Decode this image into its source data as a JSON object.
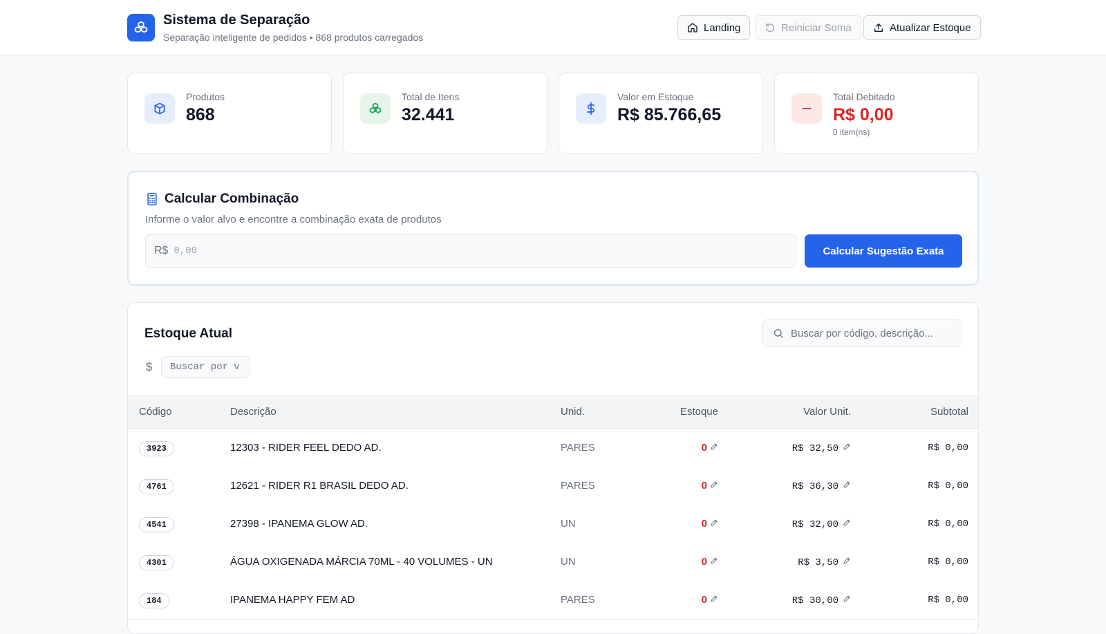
{
  "header": {
    "title": "Sistema de Separação",
    "subtitle": "Separação inteligente de pedidos • 868 produtos carregados",
    "buttons": {
      "landing": "Landing",
      "reset": "Reiniciar Soma",
      "update": "Atualizar Estoque"
    }
  },
  "stats": [
    {
      "label": "Produtos",
      "value": "868",
      "icon": "cube-icon",
      "color": "#2563eb"
    },
    {
      "label": "Total de Itens",
      "value": "32.441",
      "icon": "boxes-icon",
      "color": "#16a34a"
    },
    {
      "label": "Valor em Estoque",
      "value": "R$ 85.766,65",
      "icon": "dollar-icon",
      "color": "#2563eb"
    },
    {
      "label": "Total Debitado",
      "value": "R$ 0,00",
      "sub": "0 item(ns)",
      "icon": "minus-icon",
      "color": "#dc2626"
    }
  ],
  "calc": {
    "title": "Calcular Combinação",
    "description": "Informe o valor alvo e encontre a combinação exata de produtos",
    "currency": "R$",
    "placeholder": "0,00",
    "button": "Calcular Sugestão Exata"
  },
  "stock": {
    "title": "Estoque Atual",
    "search_placeholder": "Buscar por código, descrição...",
    "value_search_symbol": "$",
    "value_search_placeholder": "Buscar por v",
    "columns": [
      "Código",
      "Descrição",
      "Unid.",
      "Estoque",
      "Valor Unit.",
      "Subtotal"
    ],
    "rows": [
      {
        "code": "3923",
        "desc": "12303 - RIDER FEEL DEDO AD.",
        "unit": "PARES",
        "stock": "0",
        "price": "R$ 32,50",
        "subtotal": "R$ 0,00"
      },
      {
        "code": "4761",
        "desc": "12621 - RIDER R1 BRASIL DEDO AD.",
        "unit": "PARES",
        "stock": "0",
        "price": "R$ 36,30",
        "subtotal": "R$ 0,00"
      },
      {
        "code": "4541",
        "desc": "27398 - IPANEMA GLOW AD.",
        "unit": "UN",
        "stock": "0",
        "price": "R$ 32,00",
        "subtotal": "R$ 0,00"
      },
      {
        "code": "4301",
        "desc": "ÁGUA OXIGENADA MÁRCIA 70ML - 40 VOLUMES - UN",
        "unit": "UN",
        "stock": "0",
        "price": "R$ 3,50",
        "subtotal": "R$ 0,00"
      },
      {
        "code": "184",
        "desc": "IPANEMA HAPPY FEM AD",
        "unit": "PARES",
        "stock": "0",
        "price": "R$ 30,00",
        "subtotal": "R$ 0,00"
      }
    ]
  }
}
